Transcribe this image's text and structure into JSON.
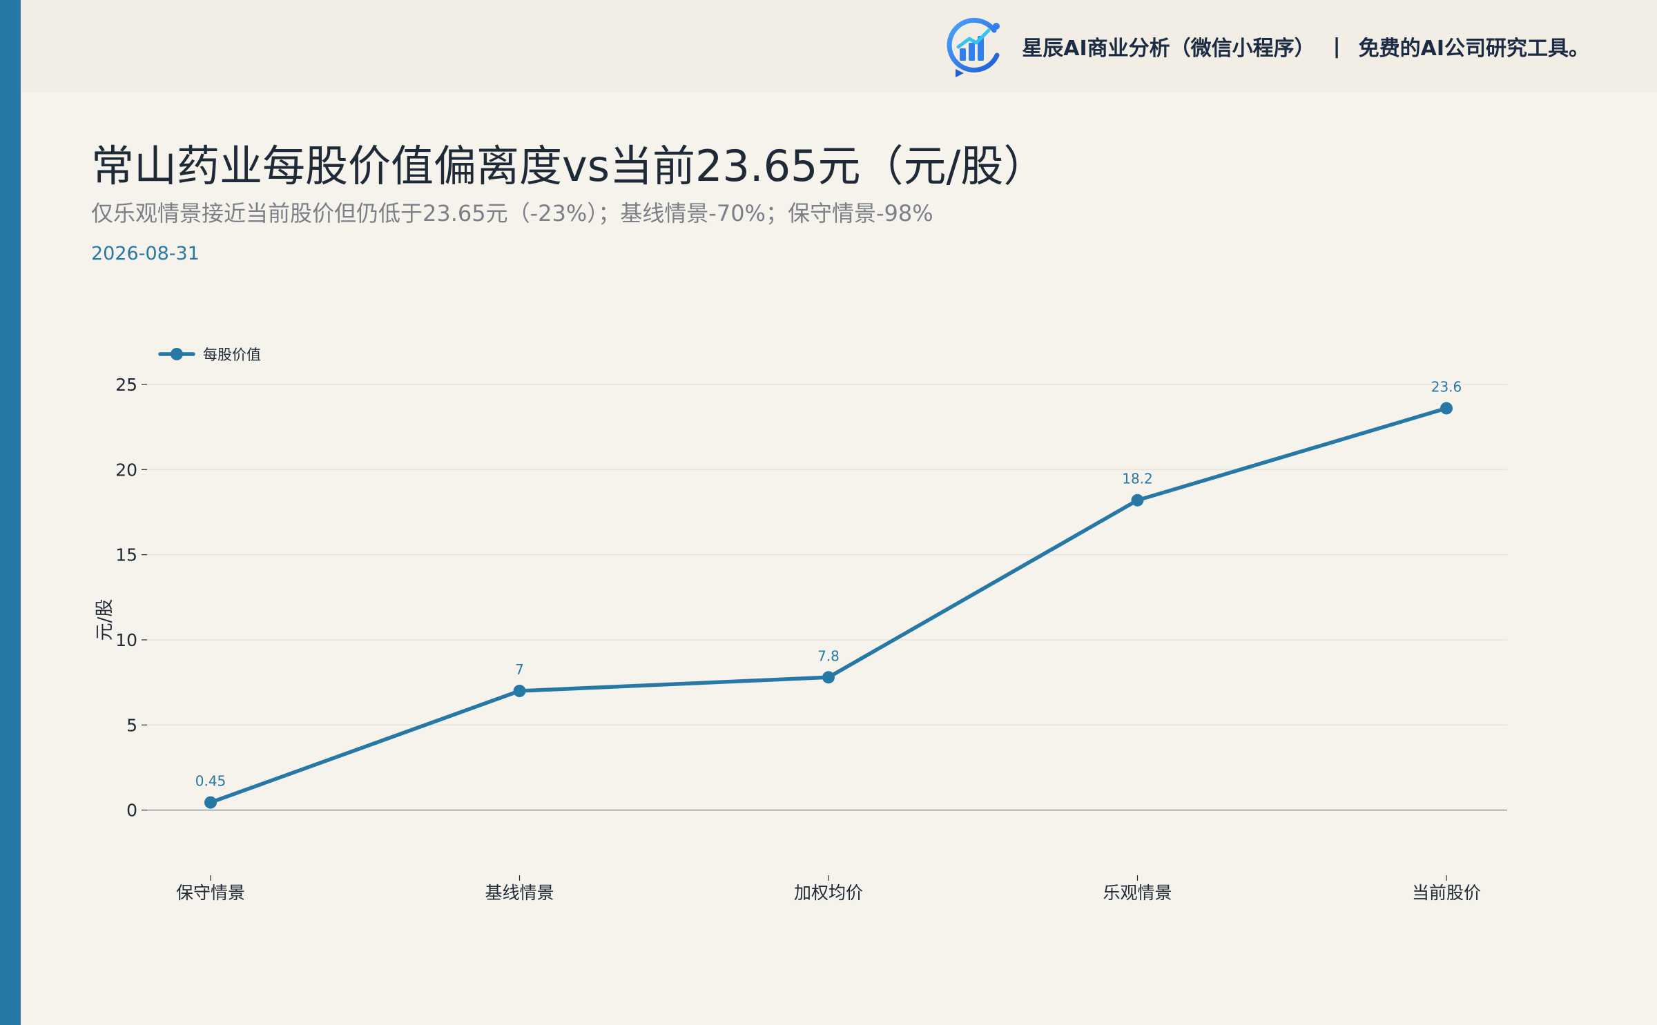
{
  "header": {
    "brand_name": "星辰AI商业分析（微信小程序）",
    "separator": "|",
    "tagline": "免费的AI公司研究工具。"
  },
  "title": "常山药业每股价值偏离度vs当前23.65元（元/股）",
  "subtitle": "仅乐观情景接近当前股价但仍低于23.65元（-23%）；基线情景-70%；保守情景-98%",
  "date": "2026-08-31",
  "colors": {
    "accent": "#2878a5",
    "series": "#2878a5",
    "background": "#f6f3ec",
    "header_background": "#f2eee6"
  },
  "chart_data": {
    "type": "line",
    "categories": [
      "保守情景",
      "基线情景",
      "加权均价",
      "乐观情景",
      "当前股价"
    ],
    "series": [
      {
        "name": "每股价值",
        "values": [
          0.45,
          7,
          7.8,
          18.2,
          23.6
        ],
        "labels": [
          "0.45",
          "7",
          "7.8",
          "18.2",
          "23.6"
        ]
      }
    ],
    "ylabel": "元/股",
    "xlabel": "",
    "ylim": [
      -3.5,
      26.5
    ],
    "yticks": [
      0,
      5,
      10,
      15,
      20,
      25
    ],
    "grid": true,
    "legend": "top-left",
    "markers": true
  }
}
